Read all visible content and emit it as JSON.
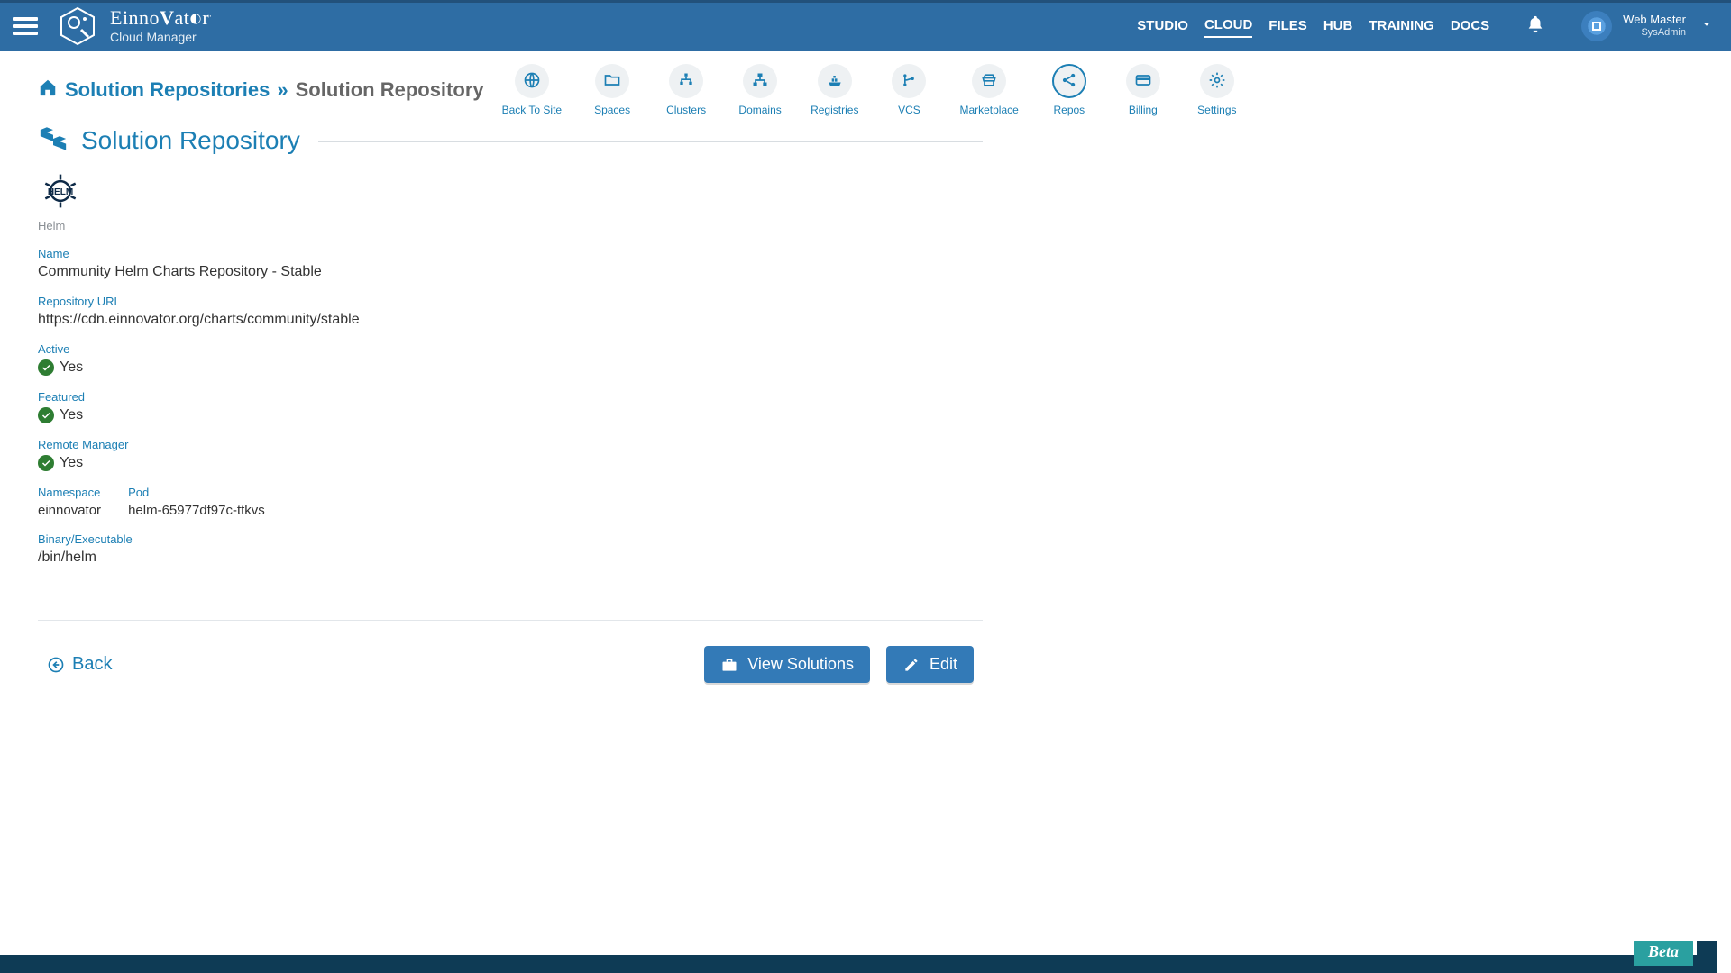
{
  "brand": {
    "name": "EinnoVator",
    "subtitle": "Cloud Manager"
  },
  "topnav": {
    "items": [
      {
        "label": "STUDIO"
      },
      {
        "label": "CLOUD",
        "active": true
      },
      {
        "label": "FILES"
      },
      {
        "label": "HUB"
      },
      {
        "label": "TRAINING"
      },
      {
        "label": "DOCS"
      }
    ]
  },
  "user": {
    "name": "Web Master",
    "role": "SysAdmin"
  },
  "breadcrumbs": {
    "root": "Solution Repositories",
    "current": "Solution Repository"
  },
  "iconnav": {
    "items": [
      {
        "key": "back",
        "label": "Back To Site"
      },
      {
        "key": "spaces",
        "label": "Spaces"
      },
      {
        "key": "clusters",
        "label": "Clusters"
      },
      {
        "key": "domains",
        "label": "Domains"
      },
      {
        "key": "registries",
        "label": "Registries"
      },
      {
        "key": "vcs",
        "label": "VCS"
      },
      {
        "key": "marketplace",
        "label": "Marketplace"
      },
      {
        "key": "repos",
        "label": "Repos",
        "active": true
      },
      {
        "key": "billing",
        "label": "Billing"
      },
      {
        "key": "settings",
        "label": "Settings"
      }
    ]
  },
  "page_title": "Solution Repository",
  "helm_caption": "Helm",
  "fields": {
    "name": {
      "label": "Name",
      "value": "Community Helm Charts Repository - Stable"
    },
    "url": {
      "label": "Repository URL",
      "value": "https://cdn.einnovator.org/charts/community/stable"
    },
    "active": {
      "label": "Active",
      "value": "Yes"
    },
    "featured": {
      "label": "Featured",
      "value": "Yes"
    },
    "remote": {
      "label": "Remote Manager",
      "value": "Yes"
    },
    "ns": {
      "label": "Namespace",
      "value": "einnovator"
    },
    "pod": {
      "label": "Pod",
      "value": "helm-65977df97c-ttkvs"
    },
    "binary": {
      "label": "Binary/Executable",
      "value": "/bin/helm"
    }
  },
  "actions": {
    "back": "Back",
    "view_solutions": "View Solutions",
    "edit": "Edit"
  },
  "footer": {
    "beta": "Beta"
  }
}
